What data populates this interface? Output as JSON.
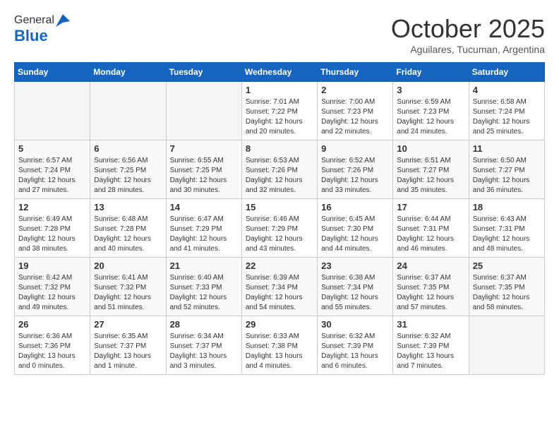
{
  "logo": {
    "general": "General",
    "blue": "Blue"
  },
  "header": {
    "month": "October 2025",
    "location": "Aguilares, Tucuman, Argentina"
  },
  "days_of_week": [
    "Sunday",
    "Monday",
    "Tuesday",
    "Wednesday",
    "Thursday",
    "Friday",
    "Saturday"
  ],
  "weeks": [
    [
      {
        "day": "",
        "info": ""
      },
      {
        "day": "",
        "info": ""
      },
      {
        "day": "",
        "info": ""
      },
      {
        "day": "1",
        "info": "Sunrise: 7:01 AM\nSunset: 7:22 PM\nDaylight: 12 hours\nand 20 minutes."
      },
      {
        "day": "2",
        "info": "Sunrise: 7:00 AM\nSunset: 7:23 PM\nDaylight: 12 hours\nand 22 minutes."
      },
      {
        "day": "3",
        "info": "Sunrise: 6:59 AM\nSunset: 7:23 PM\nDaylight: 12 hours\nand 24 minutes."
      },
      {
        "day": "4",
        "info": "Sunrise: 6:58 AM\nSunset: 7:24 PM\nDaylight: 12 hours\nand 25 minutes."
      }
    ],
    [
      {
        "day": "5",
        "info": "Sunrise: 6:57 AM\nSunset: 7:24 PM\nDaylight: 12 hours\nand 27 minutes."
      },
      {
        "day": "6",
        "info": "Sunrise: 6:56 AM\nSunset: 7:25 PM\nDaylight: 12 hours\nand 28 minutes."
      },
      {
        "day": "7",
        "info": "Sunrise: 6:55 AM\nSunset: 7:25 PM\nDaylight: 12 hours\nand 30 minutes."
      },
      {
        "day": "8",
        "info": "Sunrise: 6:53 AM\nSunset: 7:26 PM\nDaylight: 12 hours\nand 32 minutes."
      },
      {
        "day": "9",
        "info": "Sunrise: 6:52 AM\nSunset: 7:26 PM\nDaylight: 12 hours\nand 33 minutes."
      },
      {
        "day": "10",
        "info": "Sunrise: 6:51 AM\nSunset: 7:27 PM\nDaylight: 12 hours\nand 35 minutes."
      },
      {
        "day": "11",
        "info": "Sunrise: 6:50 AM\nSunset: 7:27 PM\nDaylight: 12 hours\nand 36 minutes."
      }
    ],
    [
      {
        "day": "12",
        "info": "Sunrise: 6:49 AM\nSunset: 7:28 PM\nDaylight: 12 hours\nand 38 minutes."
      },
      {
        "day": "13",
        "info": "Sunrise: 6:48 AM\nSunset: 7:28 PM\nDaylight: 12 hours\nand 40 minutes."
      },
      {
        "day": "14",
        "info": "Sunrise: 6:47 AM\nSunset: 7:29 PM\nDaylight: 12 hours\nand 41 minutes."
      },
      {
        "day": "15",
        "info": "Sunrise: 6:46 AM\nSunset: 7:29 PM\nDaylight: 12 hours\nand 43 minutes."
      },
      {
        "day": "16",
        "info": "Sunrise: 6:45 AM\nSunset: 7:30 PM\nDaylight: 12 hours\nand 44 minutes."
      },
      {
        "day": "17",
        "info": "Sunrise: 6:44 AM\nSunset: 7:31 PM\nDaylight: 12 hours\nand 46 minutes."
      },
      {
        "day": "18",
        "info": "Sunrise: 6:43 AM\nSunset: 7:31 PM\nDaylight: 12 hours\nand 48 minutes."
      }
    ],
    [
      {
        "day": "19",
        "info": "Sunrise: 6:42 AM\nSunset: 7:32 PM\nDaylight: 12 hours\nand 49 minutes."
      },
      {
        "day": "20",
        "info": "Sunrise: 6:41 AM\nSunset: 7:32 PM\nDaylight: 12 hours\nand 51 minutes."
      },
      {
        "day": "21",
        "info": "Sunrise: 6:40 AM\nSunset: 7:33 PM\nDaylight: 12 hours\nand 52 minutes."
      },
      {
        "day": "22",
        "info": "Sunrise: 6:39 AM\nSunset: 7:34 PM\nDaylight: 12 hours\nand 54 minutes."
      },
      {
        "day": "23",
        "info": "Sunrise: 6:38 AM\nSunset: 7:34 PM\nDaylight: 12 hours\nand 55 minutes."
      },
      {
        "day": "24",
        "info": "Sunrise: 6:37 AM\nSunset: 7:35 PM\nDaylight: 12 hours\nand 57 minutes."
      },
      {
        "day": "25",
        "info": "Sunrise: 6:37 AM\nSunset: 7:35 PM\nDaylight: 12 hours\nand 58 minutes."
      }
    ],
    [
      {
        "day": "26",
        "info": "Sunrise: 6:36 AM\nSunset: 7:36 PM\nDaylight: 13 hours\nand 0 minutes."
      },
      {
        "day": "27",
        "info": "Sunrise: 6:35 AM\nSunset: 7:37 PM\nDaylight: 13 hours\nand 1 minute."
      },
      {
        "day": "28",
        "info": "Sunrise: 6:34 AM\nSunset: 7:37 PM\nDaylight: 13 hours\nand 3 minutes."
      },
      {
        "day": "29",
        "info": "Sunrise: 6:33 AM\nSunset: 7:38 PM\nDaylight: 13 hours\nand 4 minutes."
      },
      {
        "day": "30",
        "info": "Sunrise: 6:32 AM\nSunset: 7:39 PM\nDaylight: 13 hours\nand 6 minutes."
      },
      {
        "day": "31",
        "info": "Sunrise: 6:32 AM\nSunset: 7:39 PM\nDaylight: 13 hours\nand 7 minutes."
      },
      {
        "day": "",
        "info": ""
      }
    ]
  ]
}
